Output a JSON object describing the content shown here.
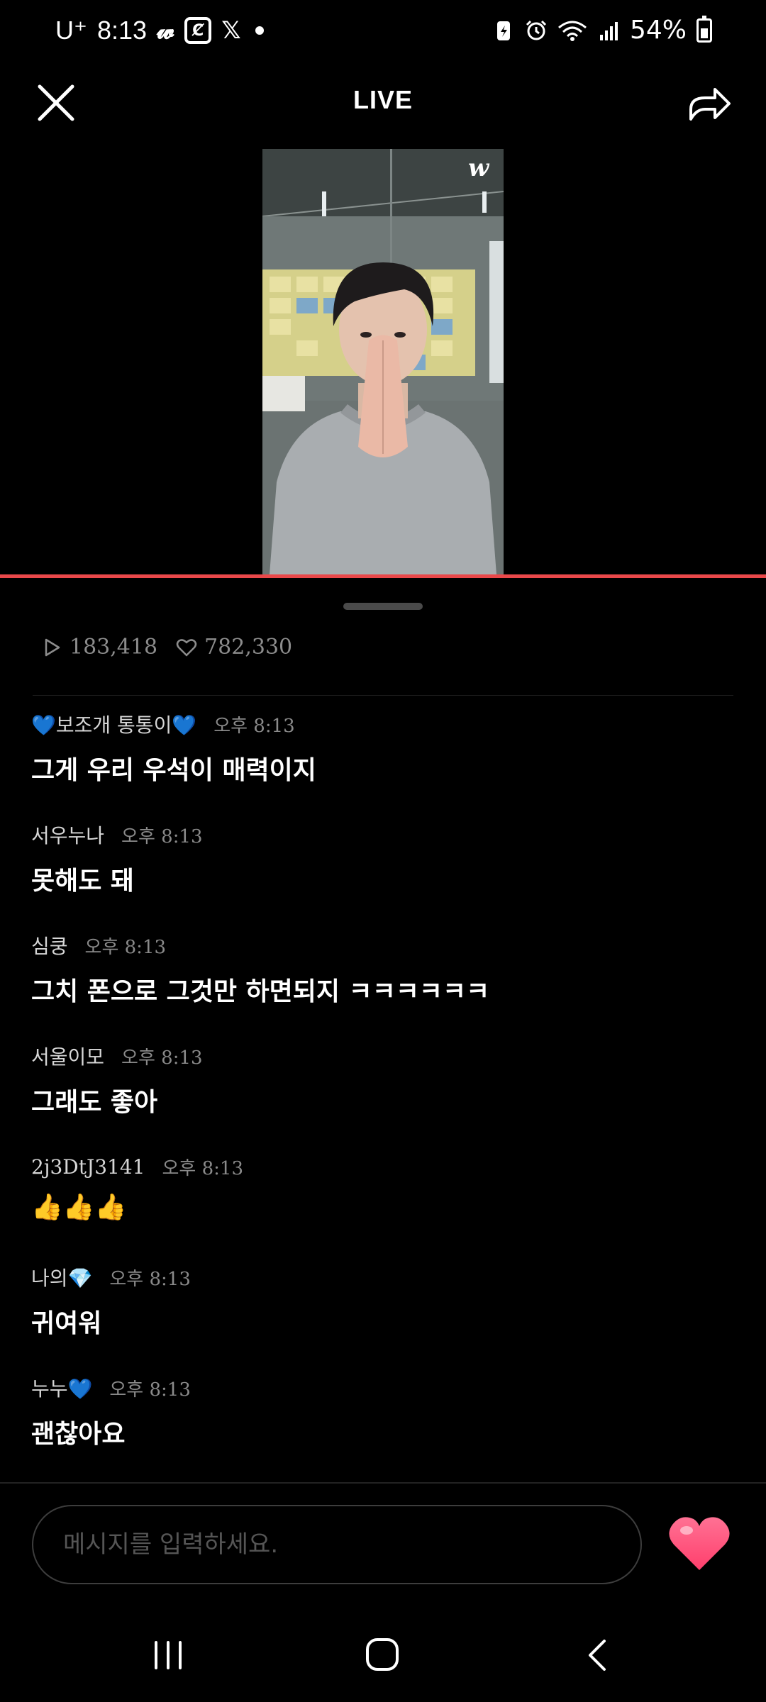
{
  "status_bar": {
    "carrier": "U⁺",
    "time": "8:13",
    "battery": "54%",
    "icons": [
      "weverse-icon",
      "app-box-icon",
      "x-icon",
      "notification-dot",
      "battery-saver-icon",
      "alarm-icon",
      "wifi-icon",
      "signal-icon",
      "battery-icon"
    ]
  },
  "header": {
    "title": "LIVE",
    "close_icon": "close-icon",
    "share_icon": "share-icon"
  },
  "video": {
    "watermark": "w"
  },
  "stats": {
    "plays": "183,418",
    "likes": "782,330"
  },
  "comments": [
    {
      "user": "💙보조개 통통이💙",
      "time": "오후 8:13",
      "text": "그게 우리 우석이 매력이지"
    },
    {
      "user": "서우누나",
      "time": "오후 8:13",
      "text": "못해도 돼"
    },
    {
      "user": "심쿵",
      "time": "오후 8:13",
      "text": "그치 폰으로 그것만 하면되지 ㅋㅋㅋㅋㅋㅋ"
    },
    {
      "user": "서울이모",
      "time": "오후 8:13",
      "text": "그래도 좋아"
    },
    {
      "user": "2j3DtJ3141",
      "time": "오후 8:13",
      "text": "👍👍👍"
    },
    {
      "user": "나의💎",
      "time": "오후 8:13",
      "text": "귀여워"
    },
    {
      "user": "누누💙",
      "time": "오후 8:13",
      "text": "괜찮아요"
    }
  ],
  "input": {
    "placeholder": "메시지를 입력하세요."
  },
  "colors": {
    "progress": "#e9484a",
    "heart": "#ff4f7b",
    "background": "#000000"
  }
}
